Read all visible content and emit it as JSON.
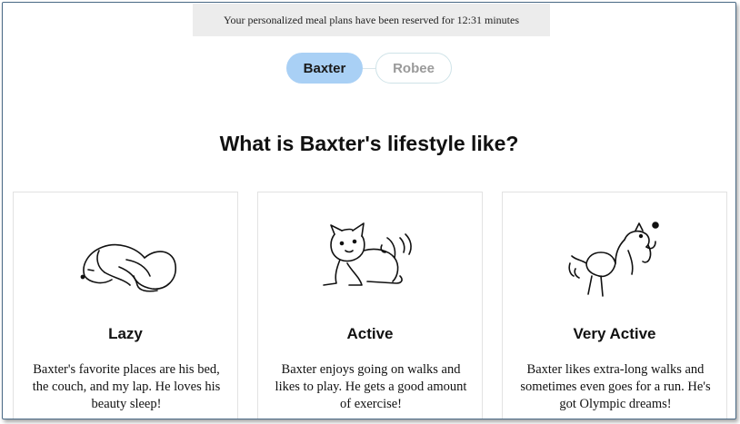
{
  "banner": {
    "text": "Your personalized meal plans have been reserved for 12:31 minutes"
  },
  "pets": [
    {
      "name": "Baxter",
      "selected": true
    },
    {
      "name": "Robee",
      "selected": false
    }
  ],
  "heading": "What is Baxter's lifestyle like?",
  "options": [
    {
      "title": "Lazy",
      "description": "Baxter's favorite places are his bed, the couch, and my lap. He loves his beauty sleep!",
      "icon": "sleeping-dog-icon"
    },
    {
      "title": "Active",
      "description": "Baxter enjoys going on walks and likes to play. He gets a good amount of exercise!",
      "icon": "playful-dog-icon"
    },
    {
      "title": "Very Active",
      "description": "Baxter likes extra-long walks and sometimes even goes for a run. He's got Olympic dreams!",
      "icon": "jumping-dog-icon"
    }
  ]
}
